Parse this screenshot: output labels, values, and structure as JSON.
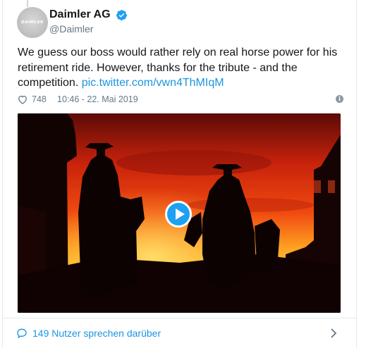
{
  "tweet": {
    "avatar_text": "DAIMLER",
    "display_name": "Daimler AG",
    "handle": "@Daimler",
    "text": "We guess our boss would rather rely on real horse power for his retirement ride. However, thanks for the tribute - and the competition.",
    "link": "pic.twitter.com/vwn4ThMIqM",
    "likes": "748",
    "timestamp": "10:46 - 22. Mai 2019"
  },
  "media": {
    "type": "video",
    "description_icon": "play-icon"
  },
  "footer": {
    "conversation_text": "149 Nutzer sprechen darüber"
  },
  "colors": {
    "link_blue": "#1b95e0",
    "verified_blue": "#1da1f2",
    "secondary_gray": "#657786"
  }
}
